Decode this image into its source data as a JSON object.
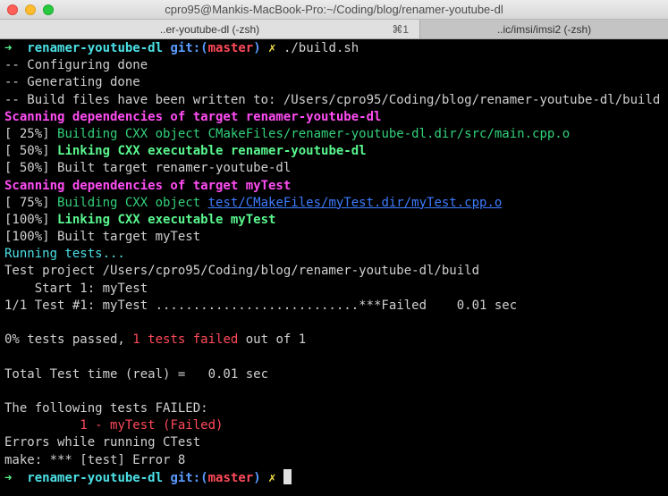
{
  "window": {
    "title": "cpro95@Mankis-MacBook-Pro:~/Coding/blog/renamer-youtube-dl",
    "tabs": [
      {
        "label": "..er-youtube-dl (-zsh)",
        "shortcut": "⌘1"
      },
      {
        "label": "..ic/imsi/imsi2 (-zsh)"
      }
    ]
  },
  "prompt": {
    "arrow": "➜",
    "dir": "renamer-youtube-dl",
    "git_prefix": "git:(",
    "branch": "master",
    "git_suffix": ")",
    "dirty": "✗"
  },
  "command": "./build.sh",
  "output": {
    "l2": "-- Configuring done",
    "l3": "-- Generating done",
    "l4": "-- Build files have been written to: /Users/cpro95/Coding/blog/renamer-youtube-dl/build",
    "l5": "Scanning dependencies of target renamer-youtube-dl",
    "l6_prefix": "[ 25%] ",
    "l6_text": "Building CXX object CMakeFiles/renamer-youtube-dl.dir/src/main.cpp.o",
    "l7_prefix": "[ 50%] ",
    "l7_text": "Linking CXX executable renamer-youtube-dl",
    "l8": "[ 50%] Built target renamer-youtube-dl",
    "l9": "Scanning dependencies of target myTest",
    "l10_prefix": "[ 75%] ",
    "l10_text": "Building CXX object ",
    "l10_link": "test/CMakeFiles/myTest.dir/myTest.cpp.o",
    "l11_prefix": "[100%] ",
    "l11_text": "Linking CXX executable myTest",
    "l12": "[100%] Built target myTest",
    "l13": "Running tests...",
    "l14": "Test project /Users/cpro95/Coding/blog/renamer-youtube-dl/build",
    "l15": "    Start 1: myTest",
    "l16": "1/1 Test #1: myTest ...........................***Failed    0.01 sec",
    "l18_a": "0% tests passed, ",
    "l18_b": "1 tests failed",
    "l18_c": " out of 1",
    "l20": "Total Test time (real) =   0.01 sec",
    "l22": "The following tests FAILED:",
    "l23": "\t  1 - myTest (Failed)",
    "l24": "Errors while running CTest",
    "l25": "make: *** [test] Error 8"
  },
  "colors": {
    "background": "#000000",
    "prompt_arrow": "#5af78e",
    "prompt_dir": "#4ce1e6",
    "git": "#5a9bff",
    "branch": "#ff4a5a",
    "dirty": "#f4e04d",
    "scanning": "#ff4df3",
    "building": "#33d17a",
    "failed": "#ff4a5a"
  }
}
